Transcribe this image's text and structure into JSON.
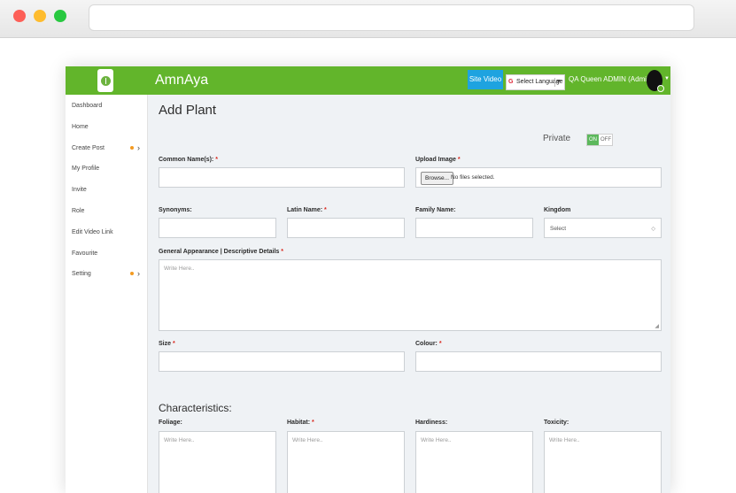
{
  "app": {
    "brand": "AmnAya",
    "site_video": "Site Video",
    "language": "Select Language",
    "language_arrow": "▼",
    "user": "QA Queen ADMIN (Admin)",
    "avatar_caret": "▼"
  },
  "sidebar": {
    "items": [
      {
        "label": "Dashboard"
      },
      {
        "label": "Home"
      },
      {
        "label": "Create Post",
        "chevron": "›"
      },
      {
        "label": "My Profile"
      },
      {
        "label": "Invite"
      },
      {
        "label": "Role"
      },
      {
        "label": "Edit Video Link"
      },
      {
        "label": "Favourite"
      },
      {
        "label": "Setting",
        "chevron": "›"
      }
    ]
  },
  "page": {
    "title": "Add Plant",
    "private_label": "Private",
    "toggle_on": "ON",
    "toggle_off": "OFF"
  },
  "form": {
    "common_names": "Common Name(s):",
    "upload_image": "Upload Image",
    "browse": "Browse...",
    "no_file": "No files selected.",
    "synonyms": "Synonyms:",
    "latin_name": "Latin Name:",
    "family_name": "Family Name:",
    "kingdom": "Kingdom",
    "kingdom_value": "Select",
    "kingdom_caret": "◇",
    "general_appearance": "General Appearance | Descriptive Details",
    "size": "Size",
    "colour": "Colour:",
    "required_mark": "*",
    "placeholder": "Write Here.."
  },
  "characteristics": {
    "title": "Characteristics:",
    "foliage": "Foliage:",
    "habitat": "Habitat:",
    "hardiness": "Hardiness:",
    "toxicity": "Toxicity:"
  },
  "colors": {
    "brand_green": "#62b52b",
    "site_video_blue": "#1ea3e0",
    "toggle_green": "#5cb85c",
    "required_red": "#d9261c",
    "notification_orange": "#f39a21"
  }
}
